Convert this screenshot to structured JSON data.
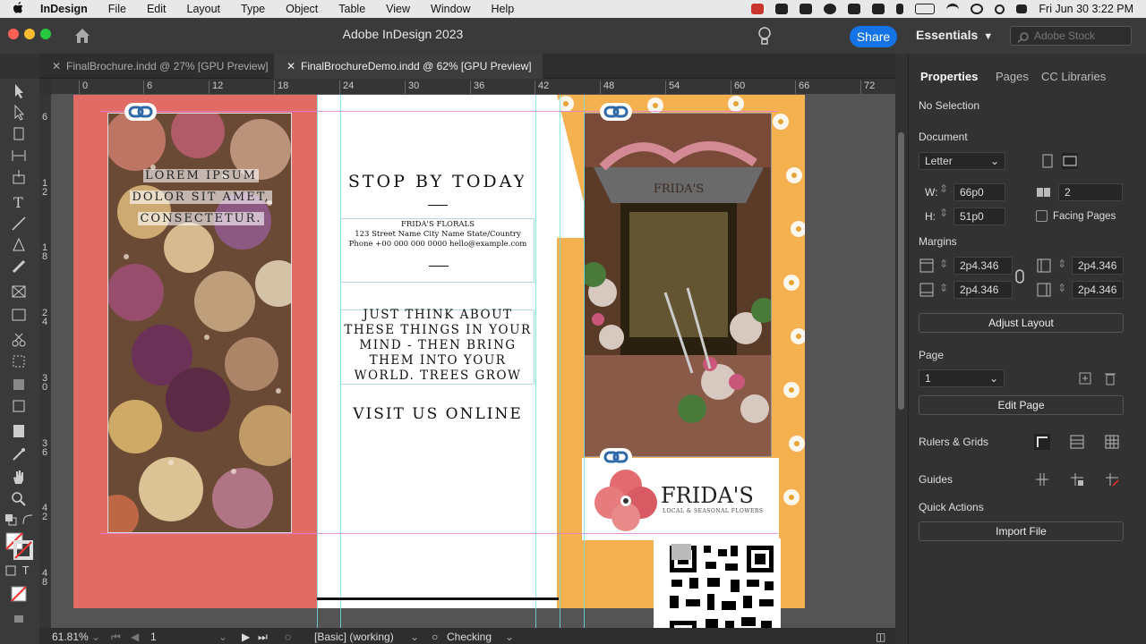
{
  "menubar": {
    "apple": "",
    "items": [
      "InDesign",
      "File",
      "Edit",
      "Layout",
      "Type",
      "Object",
      "Table",
      "View",
      "Window",
      "Help"
    ],
    "datetime": "Fri Jun 30  3:22 PM"
  },
  "titlebar": {
    "title": "Adobe InDesign 2023",
    "share_label": "Share",
    "workspace": "Essentials",
    "stock_placeholder": "Adobe Stock"
  },
  "tabs": [
    {
      "label": "FinalBrochure.indd @ 27% [GPU Preview]",
      "active": false
    },
    {
      "label": "FinalBrochureDemo.indd @ 62% [GPU Preview]",
      "active": true
    }
  ],
  "ruler": {
    "horizontal": [
      "0",
      "6",
      "12",
      "18",
      "24",
      "30",
      "36",
      "42",
      "48",
      "54",
      "60",
      "66",
      "72"
    ],
    "vertical": [
      "6",
      "1\n2",
      "1\n8",
      "2\n4",
      "3\n0",
      "3\n6",
      "4\n2",
      "4\n8"
    ]
  },
  "document": {
    "overlay_lines": [
      "LOREM IPSUM",
      "DOLOR SIT AMET,",
      "CONSECTETUR."
    ],
    "heading_stop": "STOP BY TODAY",
    "address_name": "FRIDA'S FLORALS",
    "address_street": "123 Street Name City Name State/Country",
    "address_phone": "Phone +00 000 000 0000 hello@example.com",
    "quote": "JUST THINK ABOUT THESE THINGS IN YOUR MIND - THEN BRING THEM INTO YOUR WORLD. TREES GROW",
    "heading_visit": "VISIT US ONLINE",
    "shop_sign": "FRIDA'S",
    "logo_name": "FRIDA'S",
    "logo_tagline": "LOCAL & SEASONAL FLOWERS"
  },
  "properties": {
    "tabs": [
      "Properties",
      "Pages",
      "CC Libraries"
    ],
    "selection": "No Selection",
    "document_label": "Document",
    "preset": "Letter",
    "width_label": "W:",
    "width": "66p0",
    "height_label": "H:",
    "height": "51p0",
    "pages_count": "2",
    "facing_pages_label": "Facing Pages",
    "facing_pages": false,
    "margins_label": "Margins",
    "margin_top": "2p4.346",
    "margin_bottom": "2p4.346",
    "margin_left": "2p4.346",
    "margin_right": "2p4.346",
    "adjust_layout": "Adjust Layout",
    "page_label": "Page",
    "page_value": "1",
    "edit_page": "Edit Page",
    "rulers_grids": "Rulers & Grids",
    "guides": "Guides",
    "quick_actions": "Quick Actions",
    "import_file": "Import File"
  },
  "status": {
    "zoom": "61.81%",
    "page": "1",
    "profile": "[Basic] (working)",
    "preflight": "Checking"
  },
  "colors": {
    "accent": "#1473e6",
    "coral": "#e06c65",
    "orange": "#f5b04f"
  }
}
